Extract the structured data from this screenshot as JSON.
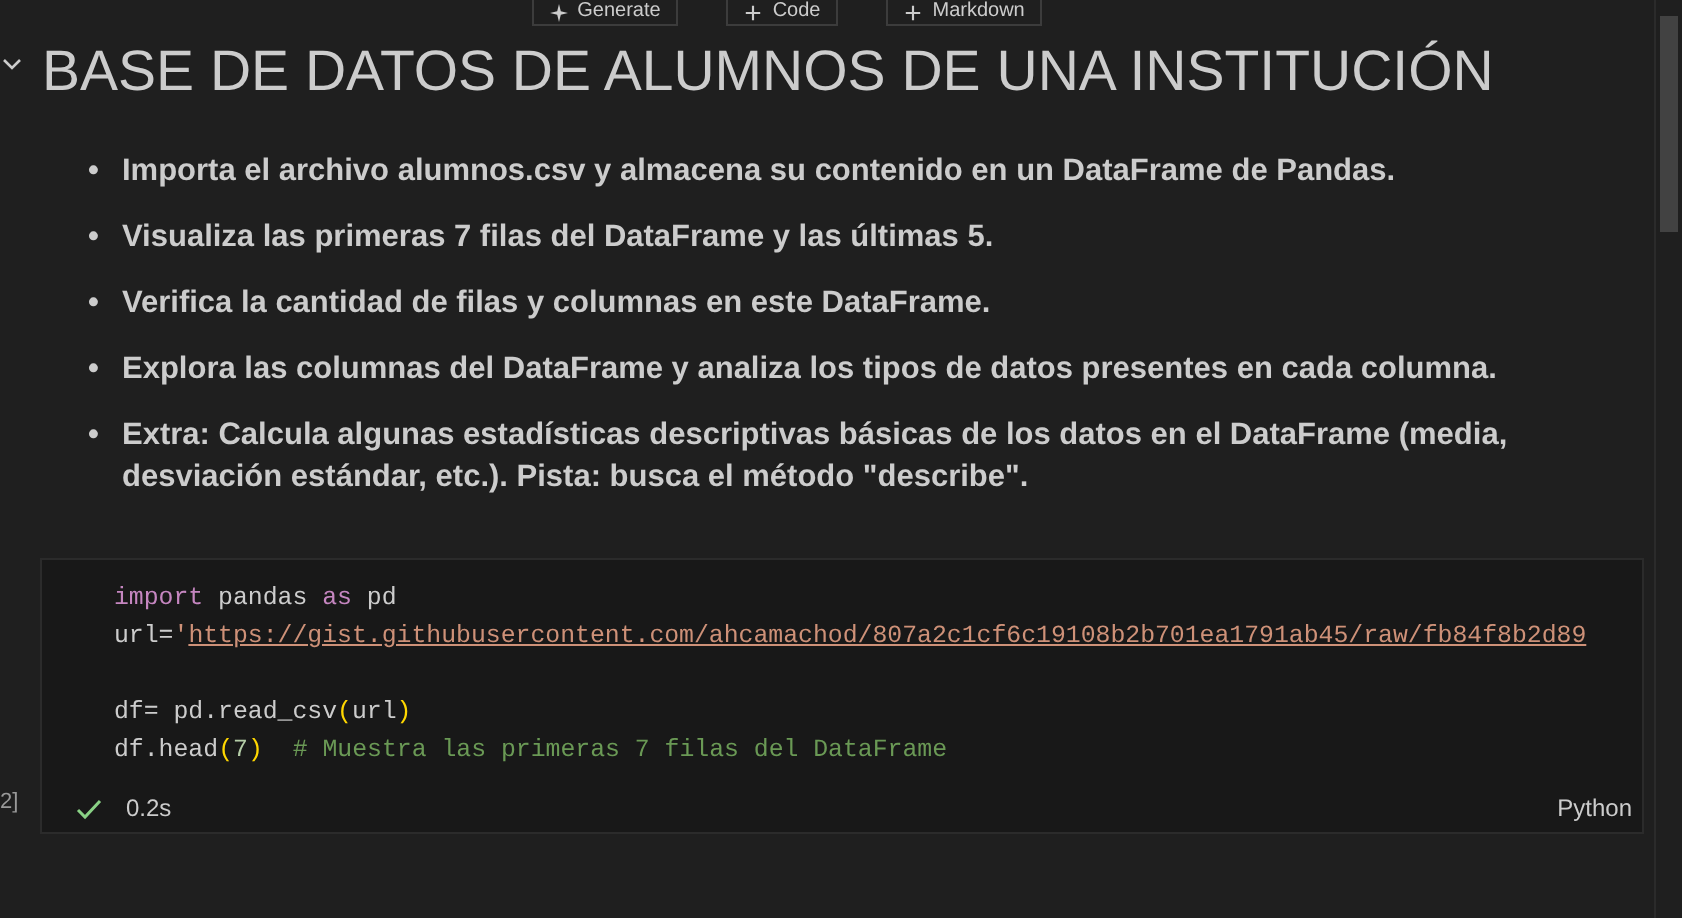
{
  "toolbar": [
    {
      "kind": "ai",
      "label": "Generate"
    },
    {
      "kind": "add",
      "label": "Code"
    },
    {
      "kind": "add",
      "label": "Markdown"
    }
  ],
  "heading": {
    "text": "BASE DE DATOS DE ALUMNOS DE UNA INSTITUCIÓN",
    "expanded": true
  },
  "bullets": [
    {
      "marker": "•",
      "text": "Importa el archivo alumnos.csv y almacena su contenido en un DataFrame de Pandas."
    },
    {
      "marker": "•",
      "text": "Visualiza las primeras 7 filas del DataFrame y las últimas 5."
    },
    {
      "marker": "•",
      "text": "Verifica la cantidad de filas y columnas en este DataFrame."
    },
    {
      "marker": "•",
      "text": "Explora las columnas del DataFrame y analiza los tipos de datos presentes en cada columna."
    },
    {
      "marker": "•",
      "text": "Extra: Calcula algunas estadísticas descriptivas básicas de los datos en el DataFrame (media, desviación estándar, etc.). Pista: busca el método \"describe\"."
    }
  ],
  "code_cell": {
    "execution_count": "2]",
    "lines": [
      {
        "kind": "code",
        "tokens": [
          {
            "kind": "keyword",
            "text": "import"
          },
          {
            "kind": "plain",
            "text": " pandas "
          },
          {
            "kind": "keyword",
            "text": "as"
          },
          {
            "kind": "plain",
            "text": " pd"
          }
        ]
      },
      {
        "kind": "code",
        "tokens": [
          {
            "kind": "plain",
            "text": "url="
          },
          {
            "kind": "string",
            "text": "'"
          },
          {
            "kind": "link",
            "text": "https://gist.githubusercontent.com/ahcamachod/807a2c1cf6c19108b2b701ea1791ab45/raw/fb84f8b2d89"
          }
        ]
      },
      {
        "kind": "blank"
      },
      {
        "kind": "code",
        "tokens": [
          {
            "kind": "plain",
            "text": "df= pd.read_csv"
          },
          {
            "kind": "paren",
            "text": "("
          },
          {
            "kind": "plain",
            "text": "url"
          },
          {
            "kind": "paren",
            "text": ")"
          }
        ]
      },
      {
        "kind": "code",
        "tokens": [
          {
            "kind": "plain",
            "text": "df.head"
          },
          {
            "kind": "paren",
            "text": "("
          },
          {
            "kind": "number",
            "text": "7"
          },
          {
            "kind": "paren",
            "text": ")"
          },
          {
            "kind": "comment",
            "text": "# Muestra las primeras 7 filas del DataFrame"
          }
        ]
      }
    ],
    "duration": "0.2s",
    "language": "Python"
  }
}
